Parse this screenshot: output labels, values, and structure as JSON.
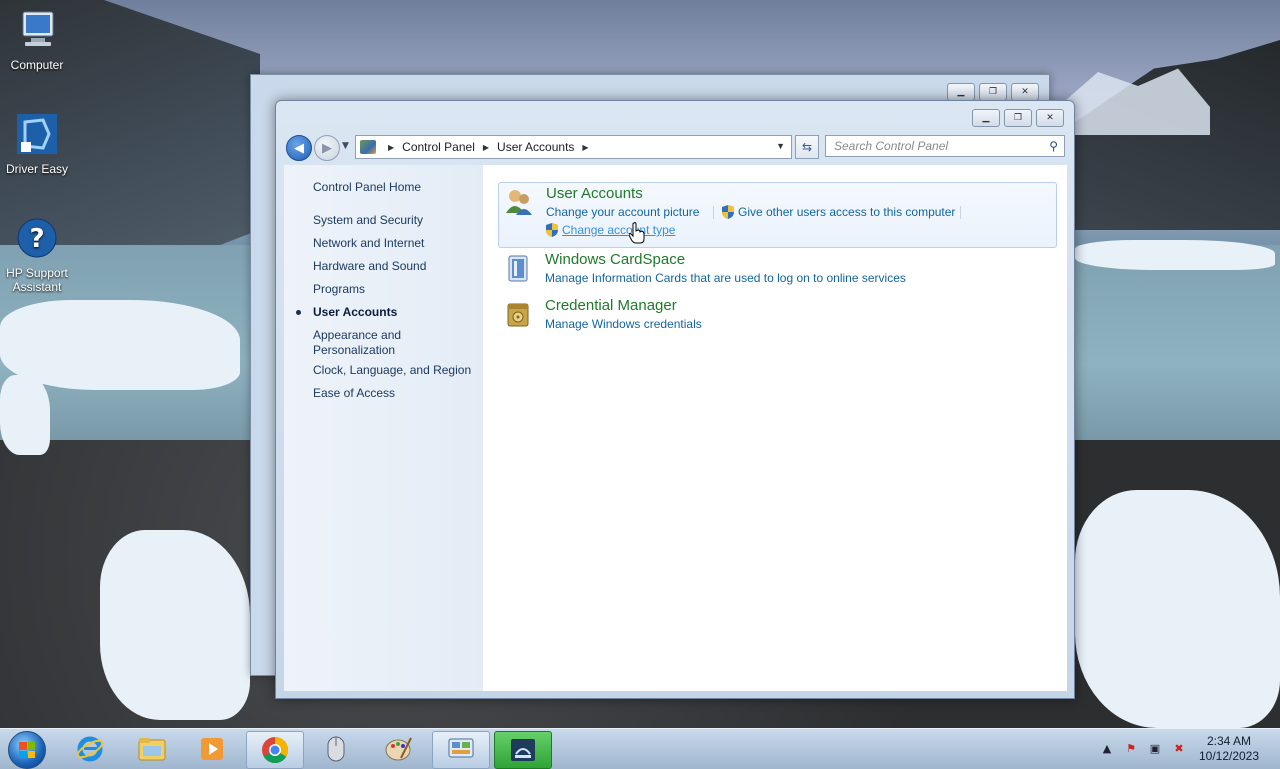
{
  "desktop": {
    "icons": [
      {
        "label": "Computer"
      },
      {
        "label": "Driver Easy"
      },
      {
        "label": "HP Support Assistant"
      }
    ]
  },
  "window": {
    "address": {
      "crumb1": "Control Panel",
      "crumb2": "User Accounts"
    },
    "search_placeholder": "Search Control Panel",
    "left_pane": {
      "home": "Control Panel Home",
      "items": [
        "System and Security",
        "Network and Internet",
        "Hardware and Sound",
        "Programs",
        "User Accounts",
        "Appearance and Personalization",
        "Clock, Language, and Region",
        "Ease of Access"
      ],
      "active": "User Accounts"
    },
    "categories": [
      {
        "title": "User Accounts",
        "links": [
          "Change your account picture",
          "Give other users access to this computer",
          "Change account type"
        ]
      },
      {
        "title": "Windows CardSpace",
        "links": [
          "Manage Information Cards that are used to log on to online services"
        ]
      },
      {
        "title": "Credential Manager",
        "links": [
          "Manage Windows credentials"
        ]
      }
    ]
  },
  "taskbar": {
    "time": "2:34 AM",
    "date": "10/12/2023"
  }
}
